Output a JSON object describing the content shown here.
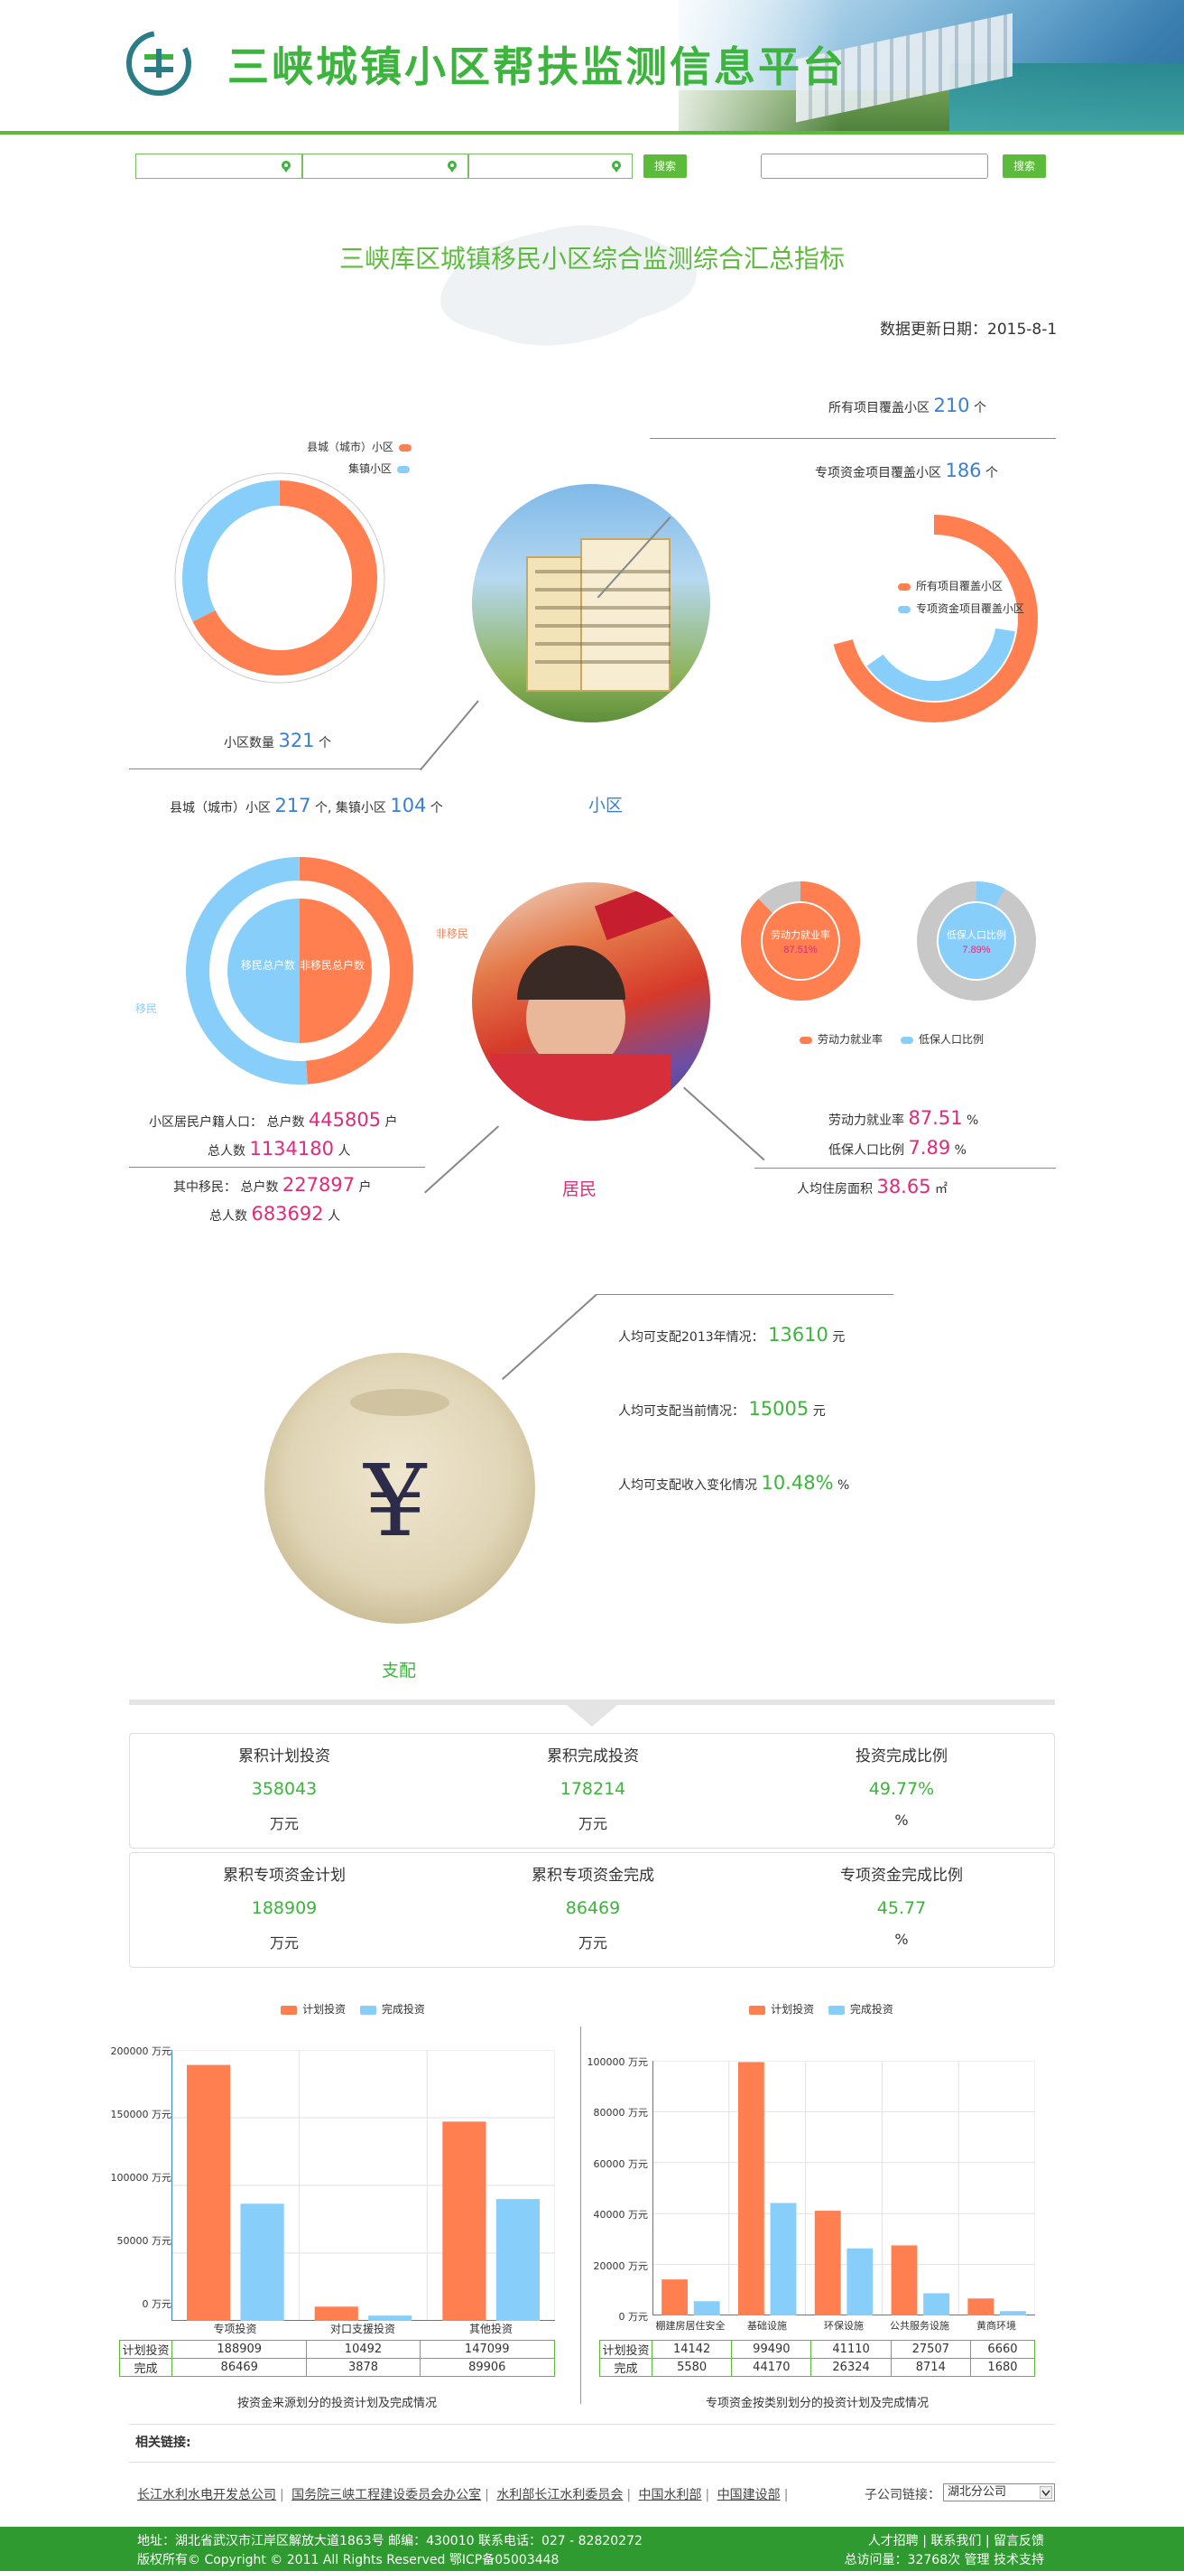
{
  "header": {
    "title": "三峡城镇小区帮扶监测信息平台"
  },
  "search": {
    "button_label": "搜索",
    "button2_label": "搜索"
  },
  "main_title": "三峡库区城镇移民小区综合监测综合汇总指标",
  "update_date": "数据更新日期：2015-8-1",
  "community": {
    "legend": [
      {
        "label": "县城（城市）小区",
        "color": "#ff7f50"
      },
      {
        "label": "集镇小区",
        "color": "#87cefa"
      }
    ],
    "count_label": "小区数量",
    "count": "321",
    "count_unit": "个",
    "breakdown_label1": "县城（城市）小区",
    "breakdown_val1": "217",
    "breakdown_mid": "个, 集镇小区",
    "breakdown_val2": "104",
    "breakdown_unit": "个",
    "section_label": "小区",
    "all_proj_label": "所有项目覆盖小区",
    "all_proj": "210",
    "all_proj_unit": "个",
    "special_label": "专项资金项目覆盖小区",
    "special": "186",
    "special_unit": "个",
    "right_legend": [
      "所有项目覆盖小区",
      "专项资金项目覆盖小区"
    ],
    "donut_values": {
      "county": 217,
      "town": 104
    },
    "arc_values": {
      "all": 210,
      "special": 186
    }
  },
  "residents": {
    "label_non": "非移民",
    "label_mig": "移民",
    "inner_left": "移民总户数",
    "inner_right": "非移民总户数",
    "hh_label": "小区居民户籍人口： 总户数",
    "hh": "445805",
    "hh_unit": "户",
    "pop_label": "总人数",
    "pop": "1134180",
    "pop_unit": "人",
    "mig_hh_label": "其中移民： 总户数",
    "mig_hh": "227897",
    "mig_hh_unit": "户",
    "mig_pop_label": "总人数",
    "mig_pop": "683692",
    "mig_pop_unit": "人",
    "section_label": "居民",
    "emp_inner": "劳动力就业率",
    "emp_inner_val": "87.51%",
    "low_inner": "低保人口比例",
    "low_inner_val": "7.89%",
    "legend_emp": "劳动力就业率",
    "legend_low": "低保人口比例",
    "emp_label": "劳动力就业率",
    "emp": "87.51",
    "emp_unit": "%",
    "low_label": "低保人口比例",
    "low": "7.89",
    "low_unit": "%",
    "area_label": "人均住房面积",
    "area": "38.65",
    "area_unit": "㎡",
    "pie_values": {
      "migrant": 227897,
      "non_migrant": 217908
    },
    "emp_fraction": 0.8751,
    "low_fraction": 0.0789
  },
  "income": {
    "r1_label": "人均可支配2013年情况：",
    "r1": "13610",
    "r1_unit": "元",
    "r2_label": "人均可支配当前情况：",
    "r2": "15005",
    "r2_unit": "元",
    "r3_label": "人均可支配收入变化情况",
    "r3": "10.48%",
    "r3_unit": "%",
    "section_label": "支配"
  },
  "summary": {
    "row1": [
      {
        "label": "累积计划投资",
        "value": "358043",
        "unit": "万元"
      },
      {
        "label": "累积完成投资",
        "value": "178214",
        "unit": "万元"
      },
      {
        "label": "投资完成比例",
        "value": "49.77%",
        "unit": "%"
      }
    ],
    "row2": [
      {
        "label": "累积专项资金计划",
        "value": "188909",
        "unit": "万元"
      },
      {
        "label": "累积专项资金完成",
        "value": "86469",
        "unit": "万元"
      },
      {
        "label": "专项资金完成比例",
        "value": "45.77",
        "unit": "%"
      }
    ]
  },
  "chart_data": [
    {
      "type": "bar",
      "title": "",
      "caption": "按资金来源划分的投资计划及完成情况",
      "categories": [
        "专项投资",
        "对口支援投资",
        "其他投资"
      ],
      "series": [
        {
          "name": "计划投资",
          "color": "#ff7f50",
          "values": [
            188909,
            10492,
            147099
          ]
        },
        {
          "name": "完成投资",
          "color": "#87cefa",
          "values": [
            86469,
            3878,
            89906
          ]
        }
      ],
      "ylim": [
        0,
        200000
      ],
      "yticks": [
        "0 万元",
        "50000 万元",
        "100000 万元",
        "150000 万元",
        "200000 万元"
      ],
      "grid": true,
      "legend": "top-center",
      "table": {
        "rows": [
          {
            "name": "计划投资",
            "values": [
              "188909",
              "10492",
              "147099"
            ]
          },
          {
            "name": "完成",
            "values": [
              "86469",
              "3878",
              "89906"
            ]
          }
        ]
      }
    },
    {
      "type": "bar",
      "title": "",
      "caption": "专项资金按类别划分的投资计划及完成情况",
      "categories": [
        "棚建房居住安全",
        "基础设施",
        "环保设施",
        "公共服务设施",
        "黄商环境"
      ],
      "series": [
        {
          "name": "计划投资",
          "color": "#ff7f50",
          "values": [
            14142,
            99490,
            41110,
            27507,
            6660
          ]
        },
        {
          "name": "完成投资",
          "color": "#87cefa",
          "values": [
            5580,
            44170,
            26324,
            8714,
            1680
          ]
        }
      ],
      "ylim": [
        0,
        100000
      ],
      "yticks": [
        "0 万元",
        "20000 万元",
        "40000 万元",
        "60000 万元",
        "80000 万元",
        "100000 万元"
      ],
      "grid": true,
      "legend": "top-center",
      "table": {
        "rows": [
          {
            "name": "计划投资",
            "values": [
              "14142",
              "99490",
              "41110",
              "27507",
              "6660"
            ]
          },
          {
            "name": "完成",
            "values": [
              "5580",
              "44170",
              "26324",
              "8714",
              "1680"
            ]
          }
        ]
      }
    }
  ],
  "footer": {
    "links_title": "相关链接:",
    "links": [
      "长江水利水电开发总公司",
      "国务院三峡工程建设委员会办公室",
      "水利部长江水利委员会",
      "中国水利部",
      "中国建设部"
    ],
    "sub_label": "子公司链接：",
    "sub_select": "湖北分公司",
    "addr": "地址：湖北省武汉市江岸区解放大道1863号 邮编：430010 联系电话：027 - 82820272",
    "copy": "版权所有© Copyright © 2011 All Rights Reserved 鄂ICP备05003448",
    "right1": "人才招聘 | 联系我们 | 留言反馈",
    "right2": "总访问量：32768次 管理 技术支持"
  }
}
